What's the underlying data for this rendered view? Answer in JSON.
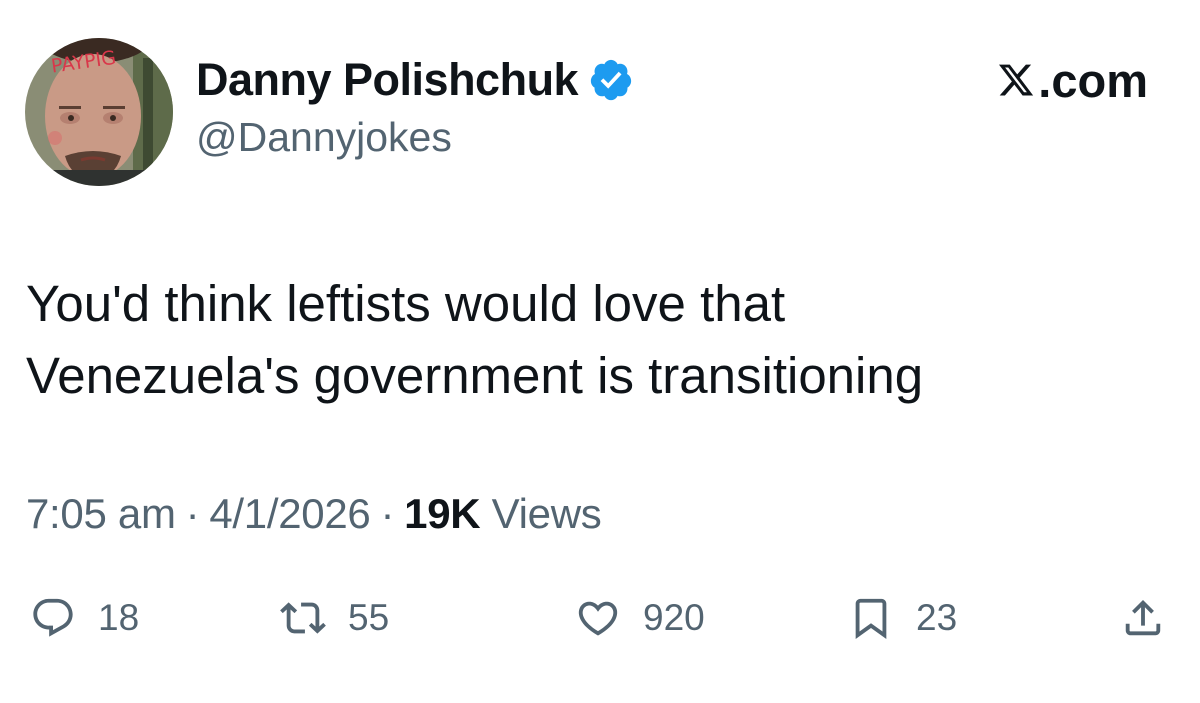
{
  "user": {
    "display_name": "Danny Polishchuk",
    "handle": "@Dannyjokes",
    "verified": true,
    "avatar_icon": "profile-photo",
    "avatar_forehead_text": "PAYPIG"
  },
  "brand": {
    "label": ".com",
    "icon": "x-logo-icon"
  },
  "tweet": {
    "lines": [
      "You'd think leftists would love that",
      "Venezuela's government is transitioning"
    ]
  },
  "meta": {
    "time": "7:05 am",
    "separator": "·",
    "date": "4/1/2026",
    "views_count": "19K",
    "views_label": "Views"
  },
  "actions": {
    "reply": {
      "icon": "reply-icon",
      "count": "18"
    },
    "retweet": {
      "icon": "retweet-icon",
      "count": "55"
    },
    "like": {
      "icon": "heart-icon",
      "count": "920"
    },
    "bookmark": {
      "icon": "bookmark-icon",
      "count": "23"
    },
    "share": {
      "icon": "share-icon"
    }
  },
  "colors": {
    "text_primary": "#0f1419",
    "text_secondary": "#536471",
    "verified_blue": "#1d9bf0",
    "background": "#ffffff"
  }
}
